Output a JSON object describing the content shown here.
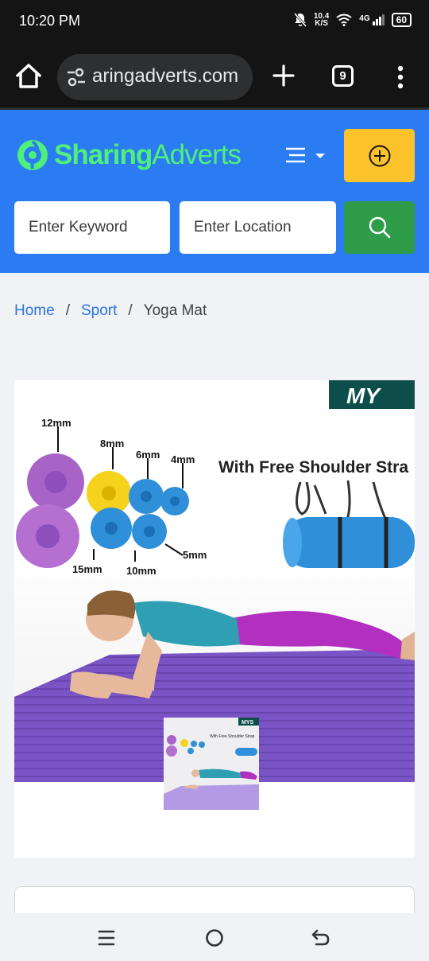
{
  "status_bar": {
    "time": "10:20 PM",
    "net_speed_value": "10.4",
    "net_speed_unit": "K/S",
    "network": "4G",
    "battery": "60",
    "icons": [
      "notifications-off-icon",
      "wifi-icon",
      "signal-icon",
      "battery-icon"
    ]
  },
  "browser": {
    "url": "sharingadverts.com",
    "url_visible": "aringadverts.com",
    "tab_count": "9",
    "icons": [
      "home-icon",
      "site-settings-icon",
      "new-tab-icon",
      "overflow-menu-icon"
    ]
  },
  "site_header": {
    "logo_bold": "Sharing",
    "logo_light": "Adverts",
    "keyword_placeholder": "Enter Keyword",
    "location_placeholder": "Enter Location",
    "colors": {
      "header_bg": "#2b7cf2",
      "post_ad": "#fbc22c",
      "search_btn": "#2e9c49",
      "logo": "#4ff07a"
    }
  },
  "breadcrumb": {
    "items": [
      "Home",
      "Sport"
    ],
    "separator": "/",
    "current": "Yoga Mat"
  },
  "product_image": {
    "banner_text": "With Free Shoulder Stra",
    "brand_text": "MY",
    "thumb_brand_text": "MYS",
    "thumb_caption": "With Free Shoulder Strap",
    "sizes": [
      "12mm",
      "8mm",
      "6mm",
      "4mm",
      "5mm",
      "15mm",
      "10mm"
    ],
    "colors": {
      "purple": "#8e4fbc",
      "yellow": "#f5d21b",
      "blue": "#2f8fd8",
      "mat": "#7a54c4"
    }
  },
  "nav_bar": {
    "icons": [
      "recents-icon",
      "home-circle-icon",
      "back-icon"
    ]
  }
}
